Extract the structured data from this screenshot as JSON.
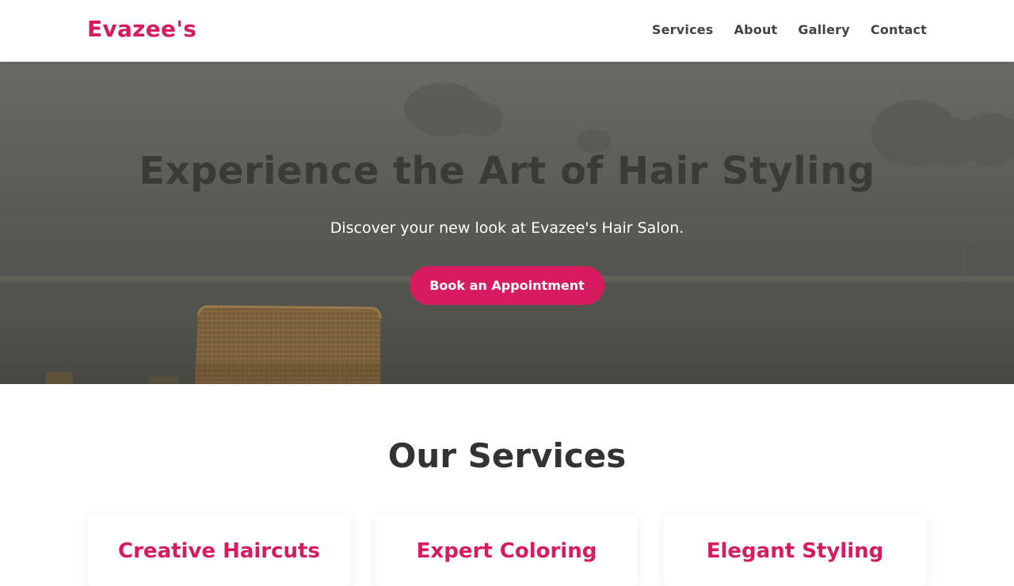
{
  "header": {
    "logo": "Evazee's",
    "nav": [
      "Services",
      "About",
      "Gallery",
      "Contact"
    ]
  },
  "hero": {
    "title": "Experience the Art of Hair Styling",
    "subtitle": "Discover your new look at Evazee's Hair Salon.",
    "cta_label": "Book an Appointment"
  },
  "services": {
    "title": "Our Services",
    "cards": [
      {
        "title": "Creative Haircuts"
      },
      {
        "title": "Expert Coloring"
      },
      {
        "title": "Elegant Styling"
      }
    ]
  },
  "colors": {
    "accent": "#d81b60",
    "nav_text": "#444444",
    "heading": "#333333"
  }
}
